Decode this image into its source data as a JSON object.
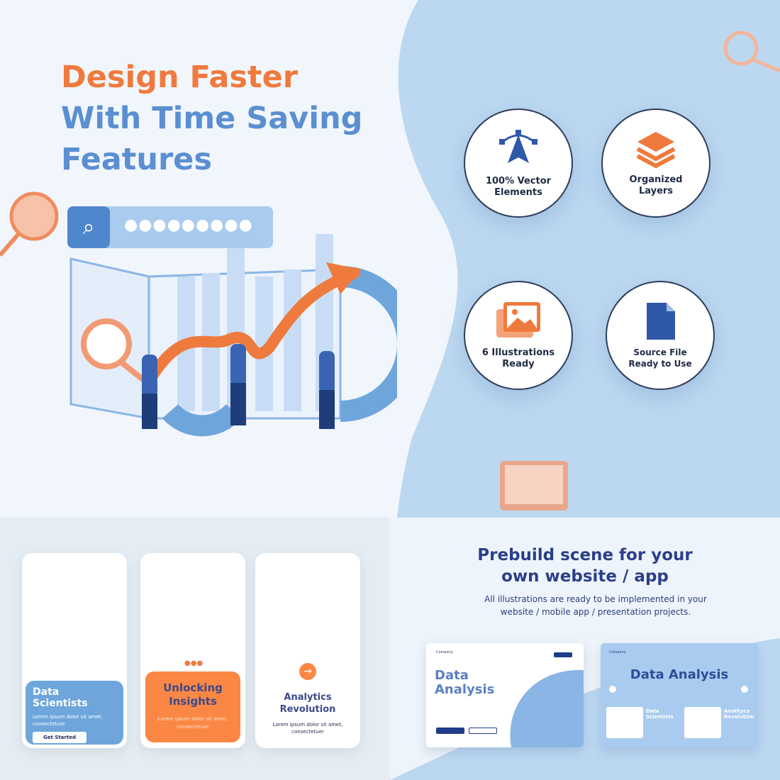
{
  "headline": {
    "line1": "Design Faster",
    "line2": "With Time Saving",
    "line3": "Features",
    "color_accent": "#ef7a3d",
    "color_primary": "#5b8fd1"
  },
  "search_mock": {
    "icon": "search-icon",
    "dots": "●●●●●●●●●"
  },
  "features": [
    {
      "icon": "vector-pen-icon",
      "label": "100% Vector Elements"
    },
    {
      "icon": "layers-icon",
      "label": "Organized Layers"
    },
    {
      "icon": "image-icon",
      "label": "6 Illustrations Ready"
    },
    {
      "icon": "file-icon",
      "label": "Source File Ready to Use"
    }
  ],
  "mobile_cards": [
    {
      "title": "Data Scientists",
      "text": "Lorem ipsum dolor sit amet, consectetuer",
      "button": "Get Started",
      "color": "#6ea6dc"
    },
    {
      "title": "Unlocking Insights",
      "text": "Lorem ipsum dolor sit amet, consectetuer",
      "color": "#fb8744"
    },
    {
      "title": "Analytics Revolution",
      "text": "Lorem ipsum dolor sit amet, consectetuer",
      "icon": "arrow-right-icon"
    }
  ],
  "prebuild": {
    "title": "Prebuild scene for your own website / app",
    "subtitle": "All illustrations are ready to be implemented in your website / mobile app / presentation projects."
  },
  "web_mocks": [
    {
      "brand": "Company",
      "title": "Data Analysis"
    },
    {
      "brand": "Company",
      "title": "Data Analysis",
      "cards": [
        "Data Scientists",
        "Analitycs Revolution"
      ]
    }
  ]
}
